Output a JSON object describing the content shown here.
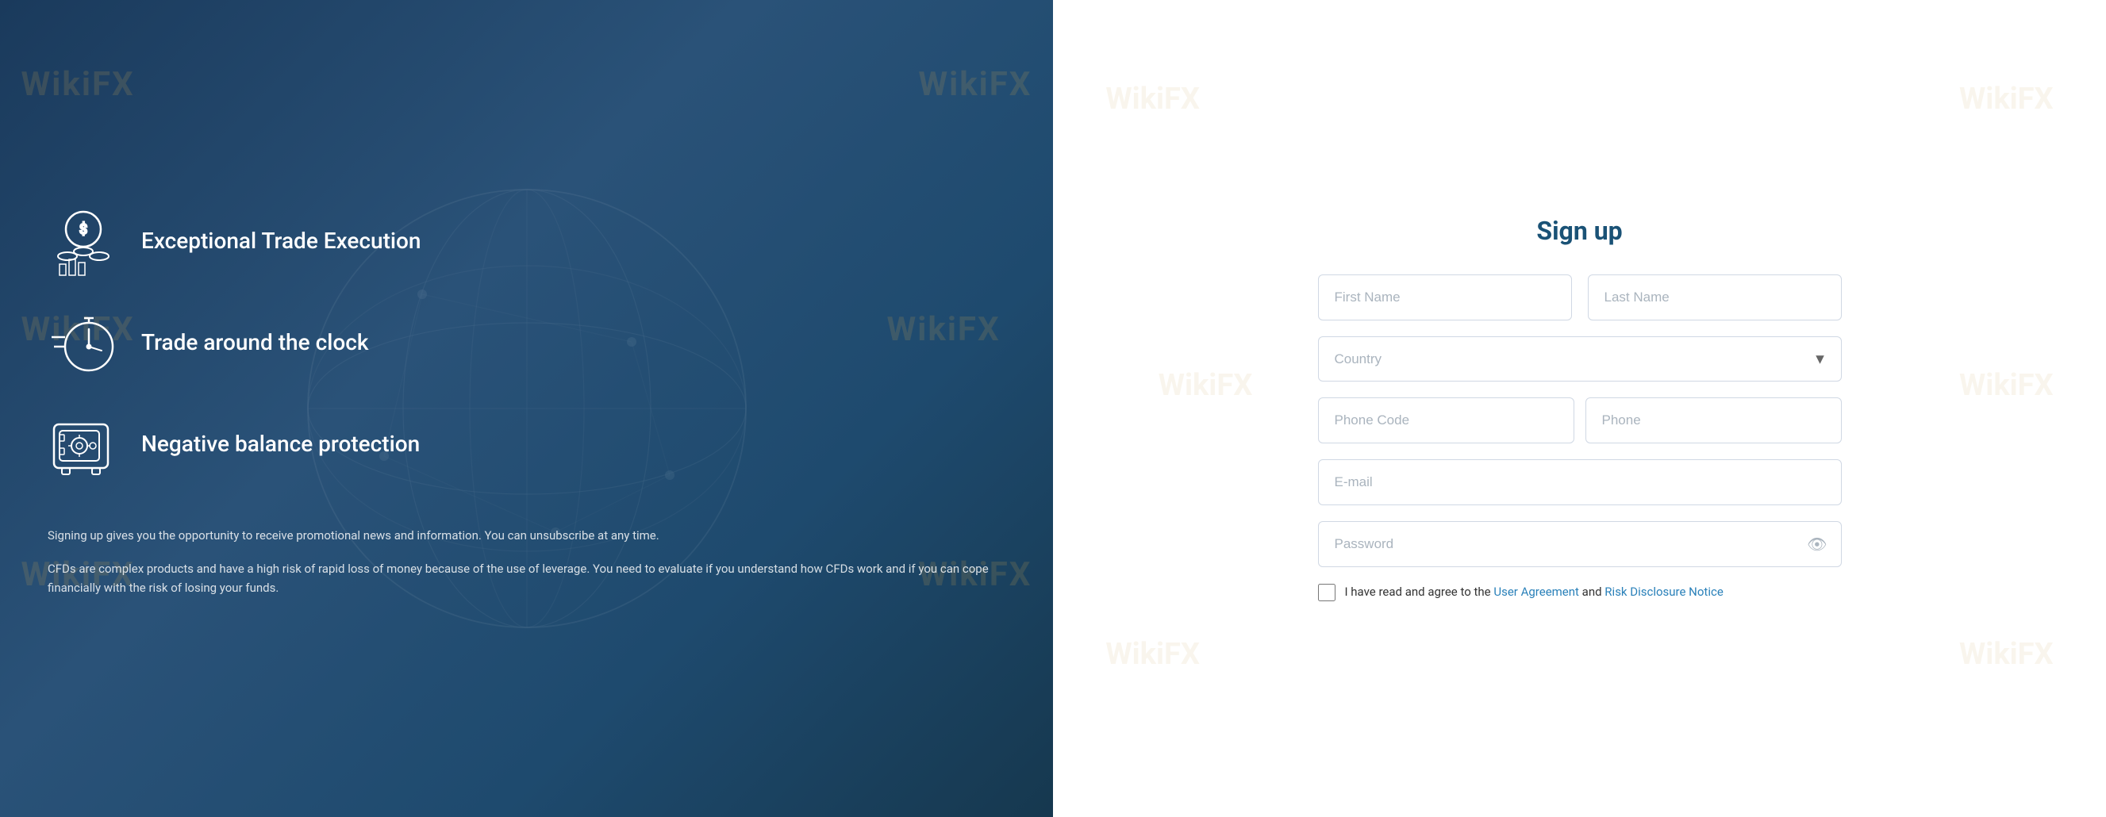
{
  "left": {
    "features": [
      {
        "id": "exceptional-trade",
        "label": "Exceptional Trade Execution",
        "icon": "chart-icon"
      },
      {
        "id": "trade-clock",
        "label": "Trade around the clock",
        "icon": "clock-icon"
      },
      {
        "id": "negative-balance",
        "label": "Negative balance protection",
        "icon": "vault-icon"
      }
    ],
    "disclaimer1": "Signing up gives you the opportunity to receive promotional news and information. You can unsubscribe at any time.",
    "disclaimer2": "CFDs are complex products and have a high risk of rapid loss of money because of the use of leverage. You need to evaluate if you understand how CFDs work and if you can cope financially with the risk of losing your funds.",
    "watermarks": [
      "WikiFX",
      "WikiFX",
      "WikiFX",
      "WikiFX",
      "WikiFX",
      "WikiFX"
    ]
  },
  "right": {
    "title": "Sign up",
    "watermarks": [
      "WikiFX",
      "WikiFX",
      "WikiFX",
      "WikiFX",
      "WikiFX",
      "WikiFX"
    ],
    "form": {
      "first_name_placeholder": "First Name",
      "last_name_placeholder": "Last Name",
      "country_placeholder": "Country",
      "country_arrow": "▼",
      "phone_code_placeholder": "Phone Code",
      "phone_placeholder": "Phone",
      "email_placeholder": "E-mail",
      "password_placeholder": "Password",
      "agreement_text": "I have read and agree to the ",
      "user_agreement_label": "User Agreement",
      "and_text": " and ",
      "risk_disclosure_label": "Risk Disclosure Notice"
    }
  }
}
